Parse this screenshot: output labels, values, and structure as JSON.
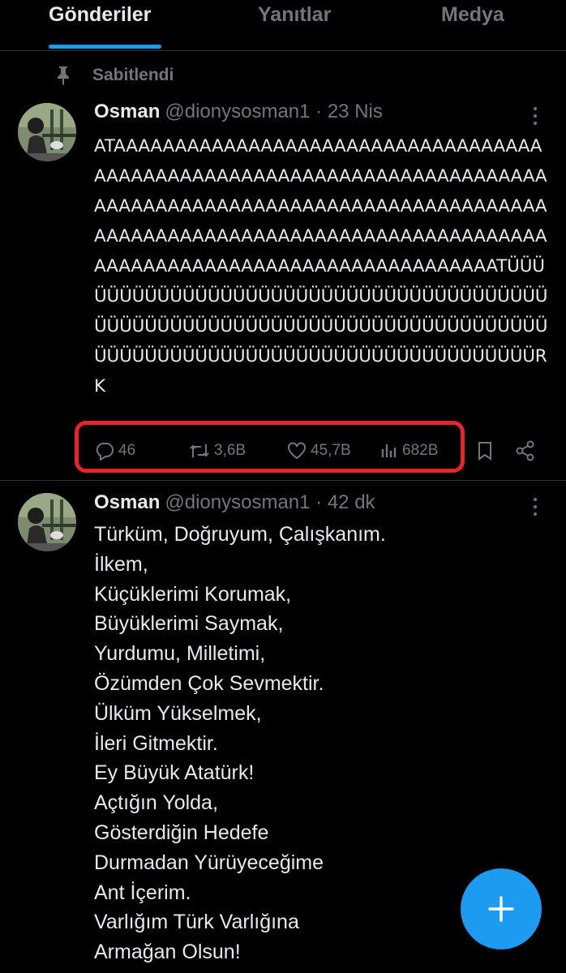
{
  "tabs": {
    "items": [
      {
        "label": "Gönderiler"
      },
      {
        "label": "Yanıtlar"
      },
      {
        "label": "Medya"
      }
    ]
  },
  "pinned_label": "Sabitlendi",
  "tweets": [
    {
      "name": "Osman",
      "meta": "@dionysosman1 · 23 Nis",
      "text": "ATAAAAAAAAAAAAAAAAAAAAAAAAAAAAAAAAAAAAAAAAAAAAAAAAAAAAAAAAAAAAAAAAAAAAAAAAAAAAAAAAAAAAAAAAAAAAAAAAAAAAAAAAAAAAAAAAAAAAAAAAAAAAAAAAAAAAAAAAAAAAAAAAAAAAAAAAAAAAAAAAAAAAAAAAAAAAAAAAAAATÜÜÜÜÜÜÜÜÜÜÜÜÜÜÜÜÜÜÜÜÜÜÜÜÜÜÜÜÜÜÜÜÜÜÜÜÜÜÜÜÜÜÜÜÜÜÜÜÜÜÜÜÜÜÜÜÜÜÜÜÜÜÜÜÜÜÜÜÜÜÜÜÜÜÜÜÜÜÜÜÜÜÜÜÜÜÜÜÜÜÜÜÜÜÜÜÜÜÜÜÜÜÜÜÜÜÜÜÜÜRK",
      "stats": {
        "replies": "46",
        "reposts": "3,6B",
        "likes": "45,7B",
        "views": "682B"
      }
    },
    {
      "name": "Osman",
      "meta": "@dionysosman1 · 42 dk",
      "text": "Türküm, Doğruyum, Çalışkanım.\nİlkem,\nKüçüklerimi Korumak,\nBüyüklerimi Saymak,\nYurdumu, Milletimi,\nÖzümden Çok Sevmektir.\nÜlküm Yükselmek,\nİleri Gitmektir.\nEy Büyük Atatürk!\nAçtığın Yolda,\nGösterdiğin Hedefe\nDurmadan Yürüyeceğime\nAnt İçerim.\nVarlığım Türk Varlığına\nArmağan Olsun!"
    }
  ],
  "colors": {
    "accent": "#1d9bf0",
    "muted": "#71767b",
    "highlight": "#e8232a",
    "background": "#000000"
  },
  "icons": [
    "pin-icon",
    "reply-icon",
    "repost-icon",
    "like-icon",
    "views-icon",
    "bookmark-icon",
    "share-icon",
    "more-icon",
    "compose-plus-icon"
  ]
}
